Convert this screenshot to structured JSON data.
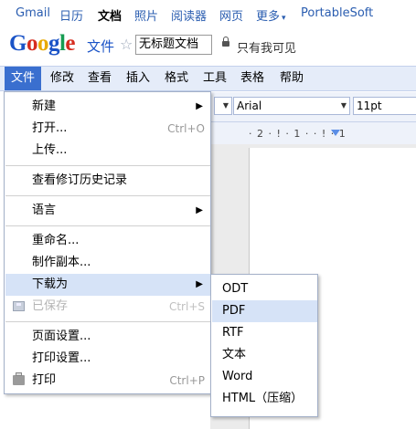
{
  "gbar": {
    "items": [
      {
        "label": "Gmail",
        "active": false
      },
      {
        "label": "日历",
        "active": false
      },
      {
        "label": "文档",
        "active": true
      },
      {
        "label": "照片",
        "active": false
      },
      {
        "label": "阅读器",
        "active": false
      },
      {
        "label": "网页",
        "active": false
      },
      {
        "label": "更多",
        "active": false
      },
      {
        "label": "PortableSoft",
        "active": false
      }
    ],
    "more_caret": "▾"
  },
  "header": {
    "logo_letters": [
      "G",
      "o",
      "o",
      "g",
      "l",
      "e"
    ],
    "product": "文件",
    "star_glyph": "☆",
    "document_title": "无标题文档",
    "share_status": "只有我可见"
  },
  "menubar": {
    "items": [
      "文件",
      "修改",
      "查看",
      "插入",
      "格式",
      "工具",
      "表格",
      "帮助"
    ],
    "active_index": 0
  },
  "toolbar": {
    "style_caret": "▼",
    "font": "Arial",
    "font_caret": "▼",
    "size": "11pt"
  },
  "ruler": {
    "text": "· 2 · ! · 1 ·   · ! · 1"
  },
  "file_menu": {
    "submenu_arrow": "▶",
    "items": [
      {
        "label": "新建",
        "shortcut": "",
        "submenu": true,
        "disabled": false
      },
      {
        "label": "打开...",
        "shortcut": "Ctrl+O",
        "submenu": false,
        "disabled": false
      },
      {
        "label": "上传...",
        "shortcut": "",
        "submenu": false,
        "disabled": false
      },
      {
        "label": "查看修订历史记录",
        "shortcut": "",
        "submenu": false,
        "disabled": false
      },
      {
        "label": "语言",
        "shortcut": "",
        "submenu": true,
        "disabled": false
      },
      {
        "label": "重命名...",
        "shortcut": "",
        "submenu": false,
        "disabled": false
      },
      {
        "label": "制作副本...",
        "shortcut": "",
        "submenu": false,
        "disabled": false
      },
      {
        "label": "下载为",
        "shortcut": "",
        "submenu": true,
        "disabled": false
      },
      {
        "label": "已保存",
        "shortcut": "Ctrl+S",
        "submenu": false,
        "disabled": true,
        "icon": "floppy-disk-icon"
      },
      {
        "label": "页面设置...",
        "shortcut": "",
        "submenu": false,
        "disabled": false
      },
      {
        "label": "打印设置...",
        "shortcut": "",
        "submenu": false,
        "disabled": false
      },
      {
        "label": "打印",
        "shortcut": "Ctrl+P",
        "submenu": false,
        "disabled": false,
        "icon": "printer-icon"
      }
    ],
    "highlighted_index": 7
  },
  "download_submenu": {
    "items": [
      "ODT",
      "PDF",
      "RTF",
      "文本",
      "Word",
      "HTML（压缩）"
    ],
    "highlighted_index": 1
  },
  "colors": {
    "menubar_bg": "#e5ecf9",
    "menu_active_bg": "#3a6fcf",
    "menu_highlight_bg": "#d6e3f7",
    "link_blue": "#2a5db0"
  }
}
